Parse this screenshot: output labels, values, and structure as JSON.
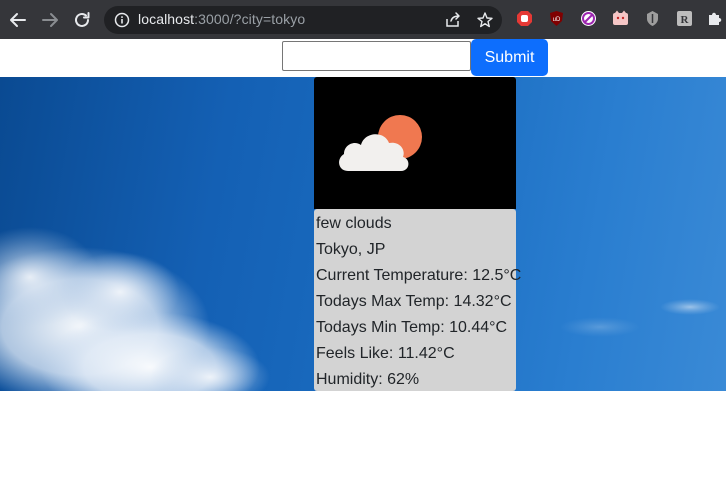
{
  "browser": {
    "url_host": "localhost",
    "url_rest": ":3000/?city=tokyo"
  },
  "form": {
    "city_value": "",
    "submit_label": "Submit"
  },
  "weather": {
    "icon": "few-clouds-icon",
    "description": "few clouds",
    "location": "Tokyo, JP",
    "current_temp": "Current Temperature: 12.5°C",
    "max_temp": "Todays Max Temp: 14.32°C",
    "min_temp": "Todays Min Temp: 10.44°C",
    "feels_like": "Feels Like: 11.42°C",
    "humidity": "Humidity: 62%"
  },
  "colors": {
    "accent": "#0d6efd",
    "card": "#d3d3d3",
    "sun": "#f07850",
    "cloud": "#f2f0ee"
  }
}
